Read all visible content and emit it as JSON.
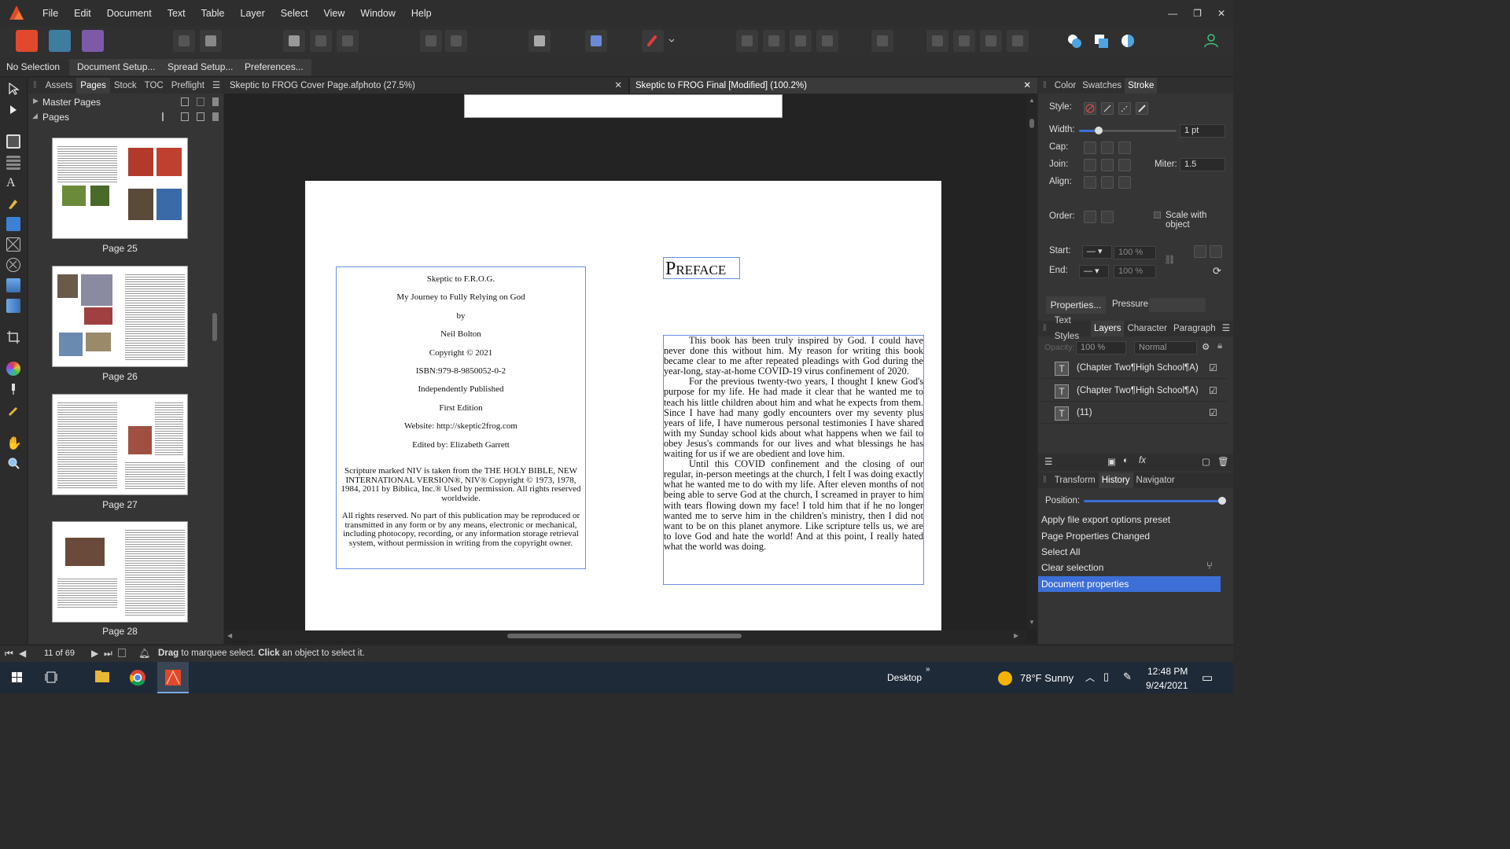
{
  "menu": [
    "File",
    "Edit",
    "Document",
    "Text",
    "Table",
    "Layer",
    "Select",
    "View",
    "Window",
    "Help"
  ],
  "window_controls": [
    "—",
    "❐",
    "✕"
  ],
  "context": {
    "selection": "No Selection",
    "buttons": [
      "Document Setup...",
      "Spread Setup...",
      "Preferences..."
    ]
  },
  "left_panel": {
    "tabs": [
      "Assets",
      "Pages",
      "Stock",
      "TOC",
      "Preflight"
    ],
    "active_tab": "Pages",
    "master_pages": "Master Pages",
    "pages": "Pages",
    "thumbs": [
      "Page 25",
      "Page 26",
      "Page 27",
      "Page 28"
    ]
  },
  "doc_tabs": [
    {
      "label": "Skeptic to FROG Cover Page.afphoto (27.5%)"
    },
    {
      "label": "Skeptic to FROG Final [Modified] (100.2%)"
    }
  ],
  "copyright_page": {
    "lines": [
      "Skeptic to F.R.O.G.",
      "My Journey to Fully Relying on God",
      "by",
      "Neil Bolton",
      "Copyright © 2021",
      "ISBN:979-8-9850052-0-2",
      "Independently Published",
      "First Edition",
      "Website: http://skeptic2frog.com",
      "Edited by: Elizabeth Garrett"
    ],
    "scripture": "Scripture marked NIV is taken from the THE HOLY BIBLE, NEW INTERNATIONAL VERSION®, NIV® Copyright © 1973, 1978, 1984, 2011 by Biblica, Inc.® Used by permission. All rights reserved worldwide.",
    "rights": "All rights reserved. No part of this publication may be reproduced or transmitted in any form or by any means, electronic or mechanical, including photocopy, recording, or any information storage retrieval system, without permission in writing from the copyright owner."
  },
  "preface": {
    "title": "Preface",
    "paragraphs": [
      "This book has been truly inspired by God. I could have never done this without him. My reason for writing this book became clear to me after repeated pleadings with God during the year-long, stay-at-home COVID-19 virus confinement of 2020.",
      "For the previous twenty-two years, I thought I knew God's purpose for my life. He had made it clear that he wanted me to teach his little children about him and what he expects from them. Since I have had many godly encounters over my seventy plus years of life, I have numerous personal testimonies I have shared with my Sunday school kids about what happens when we fail to obey Jesus's commands for our lives and what blessings he has waiting for us if we are obedient and love him.",
      "Until this COVID confinement and the closing of our regular, in-person meetings at the church, I felt I was doing exactly what he wanted me to do with my life. After eleven months of not being able to serve God at the church, I screamed in prayer to him with tears flowing down my face! I told him that if he no longer wanted me to serve him in the children's ministry, then I did not want to be on this planet anymore. Like scripture tells us, we are to love God and hate the world! And at this point, I really hated what the world was doing."
    ]
  },
  "right_panel": {
    "top_tabs": [
      "Color",
      "Swatches",
      "Stroke"
    ],
    "active_top": "Stroke",
    "style_label": "Style:",
    "width_label": "Width:",
    "width_value": "1 pt",
    "width_level": 0.2,
    "cap_label": "Cap:",
    "join_label": "Join:",
    "miter_label": "Miter:",
    "miter_value": "1.5",
    "align_label": "Align:",
    "order_label": "Order:",
    "scale_label": "Scale with object",
    "start_label": "Start:",
    "end_label": "End:",
    "start_pct": "100 %",
    "end_pct": "100 %",
    "properties_btn": "Properties...",
    "pressure_label": "Pressure:",
    "mid_tabs": [
      "Text Styles",
      "Layers",
      "Character",
      "Paragraph"
    ],
    "active_mid": "Layers",
    "opacity_label": "Opacity:",
    "opacity_value": "100 %",
    "blend_value": "Normal",
    "layers": [
      "(Chapter Two¶High School¶A)",
      "(Chapter Two¶High School¶A)",
      "(11)"
    ],
    "bottom_tabs": [
      "Transform",
      "History",
      "Navigator"
    ],
    "active_bottom": "History",
    "position_label": "Position:",
    "position_level": 1.0,
    "history": [
      "Apply file export options preset",
      "Page Properties Changed",
      "Select All",
      "Clear selection",
      "Document properties"
    ],
    "history_selected": 4
  },
  "status": {
    "page_counter": "11 of 69",
    "hint_bold1": "Drag",
    "hint_1": " to marquee select. ",
    "hint_bold2": "Click",
    "hint_2": " an object to select it."
  },
  "taskbar": {
    "desktop": "Desktop",
    "weather": "78°F  Sunny",
    "time": "12:48 PM",
    "date": "9/24/2021"
  },
  "colors": {
    "accent": "#3d6fd6",
    "brand": "#e0492b",
    "frame": "#6b8fe0"
  }
}
